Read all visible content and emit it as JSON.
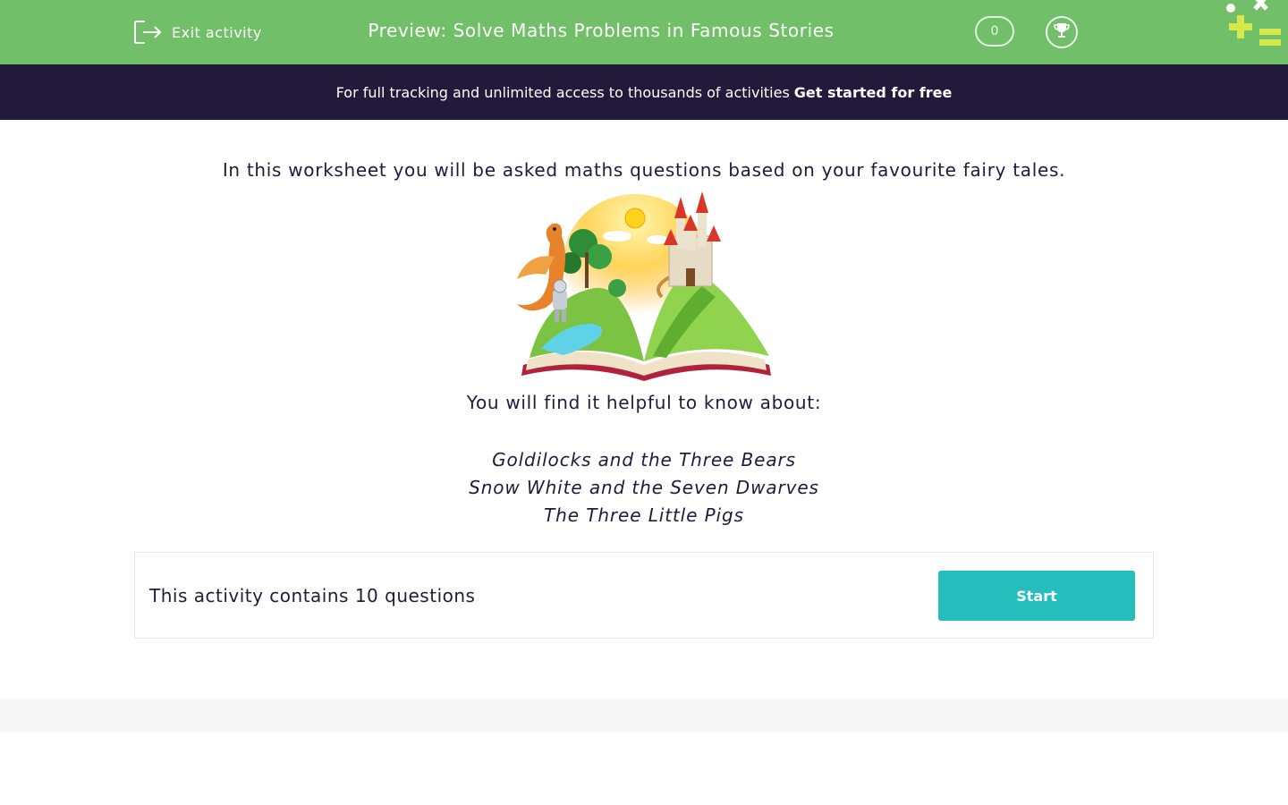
{
  "topbar": {
    "exit_label": "Exit activity",
    "title": "Preview: Solve Maths Problems in Famous Stories",
    "score": "0",
    "bg_color": "#72bf6a"
  },
  "banner": {
    "text": "For full tracking and unlimited access to thousands of activities",
    "cta": "Get started for free",
    "bg_color": "#23193a"
  },
  "intro": {
    "text": "In this worksheet you will be asked maths questions based on your favourite fairy tales."
  },
  "helpful": {
    "heading": "You will find it helpful to know about:",
    "stories": [
      "Goldilocks and the Three Bears",
      "Snow White and the Seven Dwarves",
      "The Three Little Pigs"
    ]
  },
  "activity": {
    "count_text": "This activity contains 10 questions",
    "start_label": "Start",
    "accent_color": "#26bdbd"
  }
}
